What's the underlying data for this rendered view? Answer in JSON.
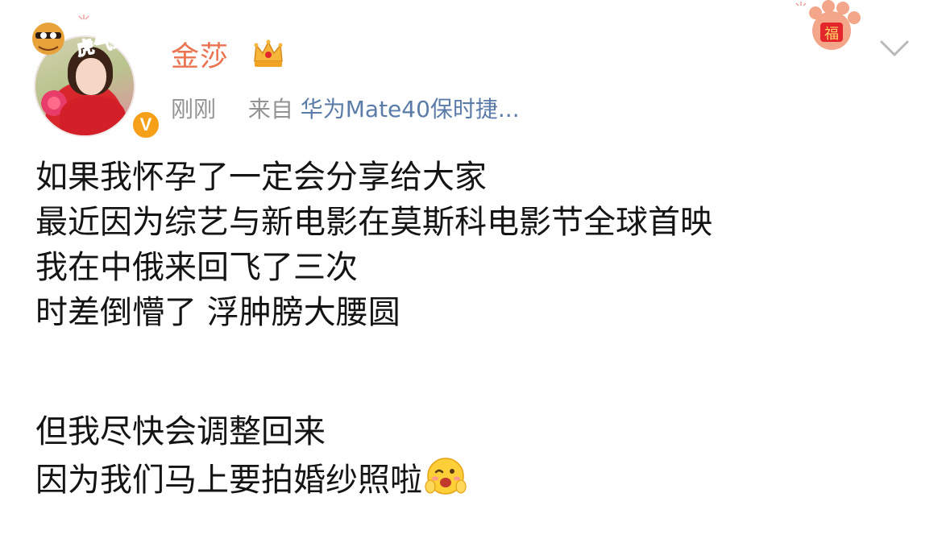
{
  "user": {
    "name": "金莎",
    "avatar_badge_text": "虎气来了",
    "verified_mark": "V"
  },
  "meta": {
    "time": "刚刚",
    "from_label": "来自",
    "source": "华为Mate40保时捷..."
  },
  "decor": {
    "badge_text": "虎气来了",
    "paw_text": "福"
  },
  "post": {
    "lines": [
      "如果我怀孕了一定会分享给大家",
      "最近因为综艺与新电影在莫斯科电影节全球首映",
      "我在中俄来回飞了三次",
      "时差倒懵了 浮肿膀大腰圆",
      "",
      "但我尽快会调整回来",
      "因为我们马上要拍婚纱照啦"
    ]
  },
  "icons": {
    "crown": "crown-icon",
    "chevron": "chevron-down-icon",
    "emoji": "wink-emoji-icon",
    "verified": "verified-badge-icon"
  },
  "colors": {
    "username": "#eb7350",
    "source_link": "#5b7ca8",
    "meta_gray": "#939393",
    "verified": "#f6a01a",
    "festive_red": "#e3262c"
  }
}
